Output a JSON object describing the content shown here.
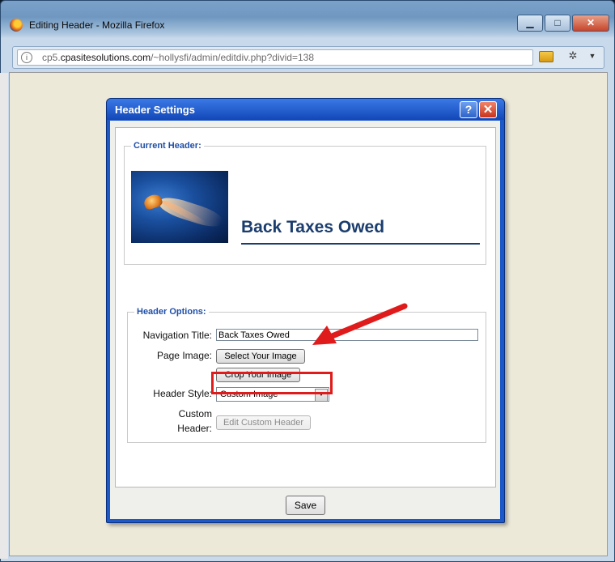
{
  "window": {
    "title": "Editing Header - Mozilla Firefox",
    "controls": {
      "minimize": "▁",
      "maximize": "□",
      "close": "✕"
    }
  },
  "urlbar": {
    "url_prefix": "cp5.",
    "url_host": "cpasitesolutions.com",
    "url_path": "/~hollysfi/admin/editdiv.php?divid=138",
    "icons": [
      "info-icon",
      "rss-icon",
      "bug-icon",
      "menu-icon"
    ]
  },
  "dialog": {
    "title": "Header Settings",
    "help_label": "?",
    "close_label": "✕",
    "current_header": {
      "legend": "Current Header:",
      "title": "Back Taxes Owed"
    },
    "options": {
      "legend": "Header Options:",
      "nav_title_label": "Navigation Title:",
      "nav_title_value": "Back Taxes Owed",
      "page_image_label": "Page Image:",
      "select_image_button": "Select Your Image",
      "crop_image_button": "Crop Your Image",
      "header_style_label": "Header Style:",
      "header_style_value": "Custom Image",
      "custom_header_label_1": "Custom",
      "custom_header_label_2": "Header:",
      "edit_custom_header_button": "Edit Custom Header"
    },
    "save_button": "Save"
  },
  "annotations": {
    "arrow_color": "#e01b1b",
    "highlight_color": "#e01b1b"
  }
}
